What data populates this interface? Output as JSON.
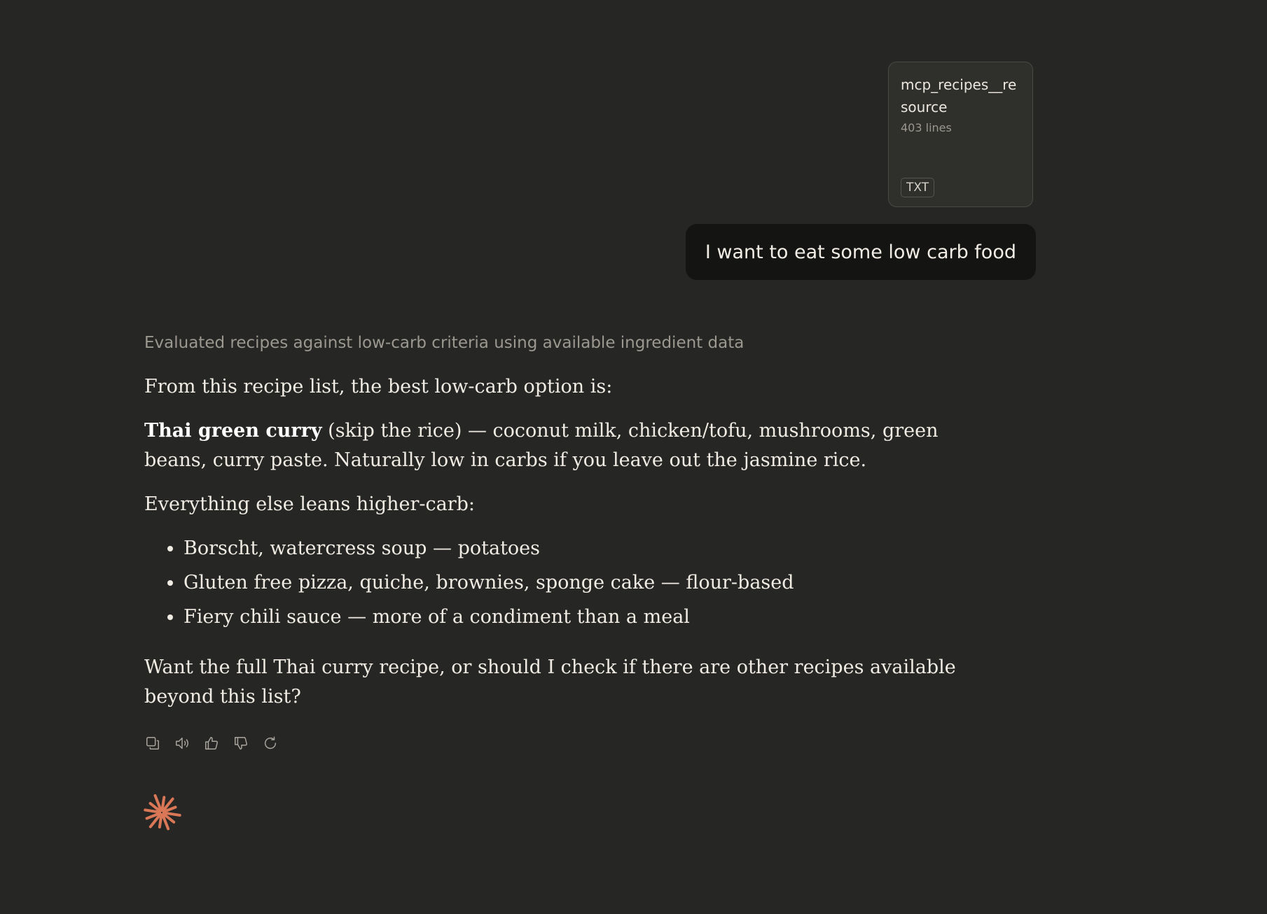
{
  "attachment": {
    "name": "mcp_recipes__resource",
    "lines": "403 lines",
    "type": "TXT"
  },
  "user_message": {
    "text": "I want to eat some low carb food"
  },
  "assistant": {
    "thinking_summary": "Evaluated recipes against low-carb criteria using available ingredient data",
    "intro": "From this recipe list, the best low-carb option is:",
    "highlight": {
      "bold": "Thai green curry",
      "rest": " (skip the rice) — coconut milk, chicken/tofu, mushrooms, green beans, curry paste. Naturally low in carbs if you leave out the jasmine rice."
    },
    "else_intro": "Everything else leans higher-carb:",
    "items": [
      "Borscht, watercress soup — potatoes",
      "Gluten free pizza, quiche, brownies, sponge cake — flour-based",
      "Fiery chili sauce — more of a condiment than a meal"
    ],
    "closing": "Want the full Thai curry recipe, or should I check if there are other recipes available beyond this list?"
  },
  "actions": {
    "icons": [
      "copy-icon",
      "speaker-icon",
      "thumbs-up-icon",
      "thumbs-down-icon",
      "retry-icon"
    ]
  },
  "colors": {
    "background": "#262624",
    "user_bubble": "#141413",
    "brand_spark": "#d97757"
  }
}
